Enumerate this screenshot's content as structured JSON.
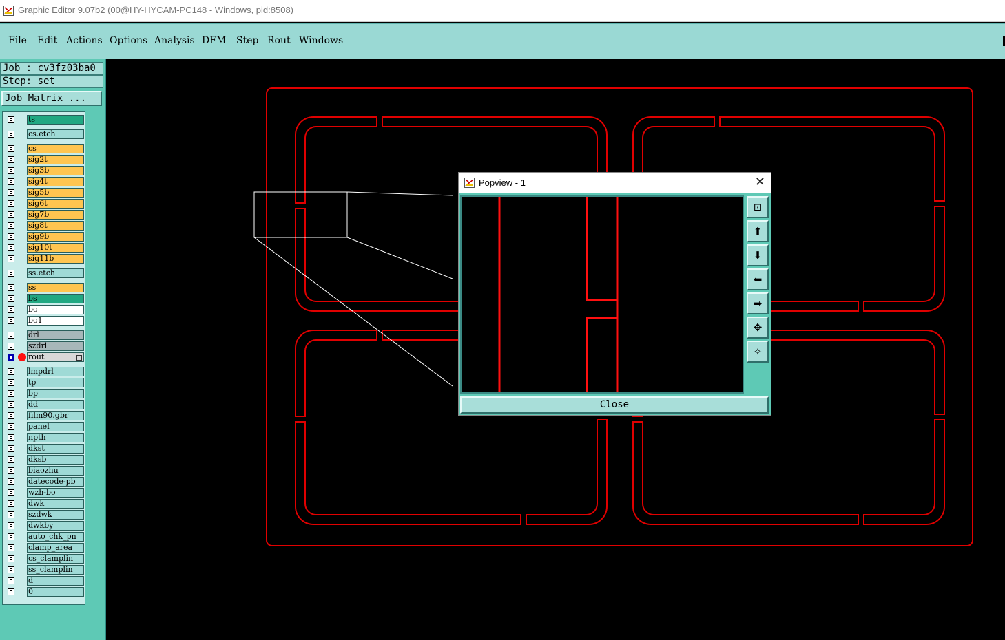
{
  "window": {
    "title": "Graphic Editor 9.07b2 (00@HY-HYCAM-PC148 - Windows, pid:8508)"
  },
  "menu": [
    "File",
    "Edit",
    "Actions",
    "Options",
    "Analysis",
    "DFM",
    "Step",
    "Rout",
    "Windows"
  ],
  "job_info": {
    "job": "Job : cv3fz03ba0",
    "step": "Step: set",
    "job_matrix_label": "Job Matrix ..."
  },
  "layers": [
    {
      "name": "ts",
      "color": "#21a882",
      "kind": "teal"
    },
    {
      "name": "cs.etch",
      "color": "#9fdad6",
      "kind": "cyan"
    },
    {
      "name": "cs",
      "color": "#ffc550",
      "kind": "orange"
    },
    {
      "name": "sig2t",
      "color": "#ffc550",
      "kind": "orange"
    },
    {
      "name": "sig3b",
      "color": "#ffc550",
      "kind": "orange"
    },
    {
      "name": "sig4t",
      "color": "#ffc550",
      "kind": "orange"
    },
    {
      "name": "sig5b",
      "color": "#ffc550",
      "kind": "orange"
    },
    {
      "name": "sig6t",
      "color": "#ffc550",
      "kind": "orange"
    },
    {
      "name": "sig7b",
      "color": "#ffc550",
      "kind": "orange"
    },
    {
      "name": "sig8t",
      "color": "#ffc550",
      "kind": "orange"
    },
    {
      "name": "sig9b",
      "color": "#ffc550",
      "kind": "orange"
    },
    {
      "name": "sig10t",
      "color": "#ffc550",
      "kind": "orange"
    },
    {
      "name": "sig11b",
      "color": "#ffc550",
      "kind": "orange"
    },
    {
      "name": "ss.etch",
      "color": "#9fdad6",
      "kind": "cyan"
    },
    {
      "name": "ss",
      "color": "#ffc550",
      "kind": "orange"
    },
    {
      "name": "bs",
      "color": "#21a882",
      "kind": "teal"
    },
    {
      "name": "bo",
      "color": "#ffffff",
      "kind": "white"
    },
    {
      "name": "bo1",
      "color": "#ffffff",
      "kind": "white"
    },
    {
      "name": "drl",
      "color": "#a7b7b9",
      "kind": "gray"
    },
    {
      "name": "szdrl",
      "color": "#a7b7b9",
      "kind": "gray"
    },
    {
      "name": "rout",
      "color": "#d8d8d8",
      "kind": "lightgray",
      "active": true
    },
    {
      "name": "lmpdrl",
      "color": "#9fdad6",
      "kind": "cyan"
    },
    {
      "name": "tp",
      "color": "#9fdad6",
      "kind": "cyan"
    },
    {
      "name": "bp",
      "color": "#9fdad6",
      "kind": "cyan"
    },
    {
      "name": "dd",
      "color": "#9fdad6",
      "kind": "cyan"
    },
    {
      "name": "film90.gbr",
      "color": "#9fdad6",
      "kind": "cyan"
    },
    {
      "name": "panel",
      "color": "#9fdad6",
      "kind": "cyan"
    },
    {
      "name": "npth",
      "color": "#9fdad6",
      "kind": "cyan"
    },
    {
      "name": "dkst",
      "color": "#9fdad6",
      "kind": "cyan"
    },
    {
      "name": "dksb",
      "color": "#9fdad6",
      "kind": "cyan"
    },
    {
      "name": "biaozhu",
      "color": "#9fdad6",
      "kind": "cyan"
    },
    {
      "name": "datecode-pb",
      "color": "#9fdad6",
      "kind": "cyan"
    },
    {
      "name": "wzh-bo",
      "color": "#9fdad6",
      "kind": "cyan"
    },
    {
      "name": "dwk",
      "color": "#9fdad6",
      "kind": "cyan"
    },
    {
      "name": "szdwk",
      "color": "#9fdad6",
      "kind": "cyan"
    },
    {
      "name": "dwkby",
      "color": "#9fdad6",
      "kind": "cyan"
    },
    {
      "name": "auto_chk_pn",
      "color": "#9fdad6",
      "kind": "cyan"
    },
    {
      "name": "clamp_area",
      "color": "#9fdad6",
      "kind": "cyan"
    },
    {
      "name": "cs_clamplin",
      "color": "#9fdad6",
      "kind": "cyan"
    },
    {
      "name": "ss_clamplin",
      "color": "#9fdad6",
      "kind": "cyan"
    },
    {
      "name": "d",
      "color": "#9fdad6",
      "kind": "cyan"
    },
    {
      "name": "0",
      "color": "#9fdad6",
      "kind": "cyan"
    }
  ],
  "popview": {
    "title": "Popview - 1",
    "close_label": "Close",
    "tools": [
      "zoom-window-icon",
      "pan-up-icon",
      "pan-down-icon",
      "pan-left-icon",
      "pan-right-icon",
      "zoom-in-icon",
      "zoom-out-icon"
    ]
  },
  "colors": {
    "rout_line": "#e00000",
    "panel_bg": "#5ec9b5",
    "menubar": "#9ad9d4"
  }
}
